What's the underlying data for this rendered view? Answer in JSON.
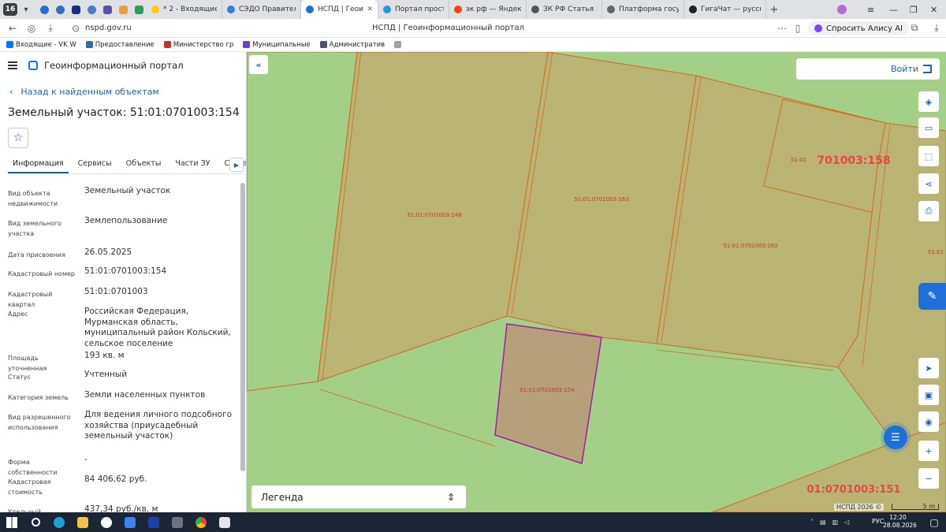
{
  "browser": {
    "tab_count": "16",
    "tabs": [
      {
        "label": "* 2 - Входящие — Я",
        "color": "#ffcc00"
      },
      {
        "label": "СЭДО Правительс",
        "color": "#3a7bd5"
      },
      {
        "label": "НСПД | Геоинфо",
        "color": "#1f6fd9",
        "active": true
      },
      {
        "label": "Портал пространс",
        "color": "#1f9bd9"
      },
      {
        "label": "эк рф — Яндекс: на",
        "color": "#fc3f1d"
      },
      {
        "label": "ЗК РФ Статья 39.6.",
        "color": "#555555"
      },
      {
        "label": "Платформа госуда",
        "color": "#666666"
      },
      {
        "label": "ГигаЧат — русско",
        "color": "#222222"
      }
    ],
    "url": "nspd.gov.ru",
    "page_title": "НСПД | Геоинформационный портал",
    "alice_label": "Спросить Алису AI",
    "bookmarks": [
      {
        "label": "Входящие - VK W",
        "color": "#0077ff"
      },
      {
        "label": "Предоставление",
        "color": "#2b6cb0"
      },
      {
        "label": "Министерство гр",
        "color": "#c53030"
      },
      {
        "label": "Муниципальные",
        "color": "#6b46c1"
      },
      {
        "label": "Административ",
        "color": "#4a5568"
      }
    ]
  },
  "panel": {
    "app_name": "Геоинформационный портал",
    "back_label": "Назад к найденным объектам",
    "object_title": "Земельный участок: 51:01:0701003:154",
    "tabs": [
      "Информация",
      "Сервисы",
      "Объекты",
      "Части ЗУ",
      "Состав"
    ],
    "properties": [
      {
        "label": "Вид объекта недвижимости",
        "value": "Земельный участок"
      },
      {
        "label": "Вид земельного участка",
        "value": "Землепользование"
      },
      {
        "label": "Дата присвоения",
        "value": "26.05.2025"
      },
      {
        "label": "Кадастровый номер",
        "value": "51:01:0701003:154"
      },
      {
        "label": "Кадастровый квартал",
        "value": "51:01:0701003"
      },
      {
        "label": "Адрес",
        "value": "Российская Федерация, Мурманская область, муниципальный район Кольский, сельское поселение"
      },
      {
        "label": "Площадь уточненная",
        "value": "193 кв. м"
      },
      {
        "label": "Статус",
        "value": "Учтенный"
      },
      {
        "label": "Категория земель",
        "value": "Земли населенных пунктов"
      },
      {
        "label": "Вид разрешенного использования",
        "value": "Для ведения личного подсобного хозяйства (приусадебный земельный участок)"
      },
      {
        "label": "Форма собственности",
        "value": "-"
      },
      {
        "label": "Кадастровая стоимость",
        "value": "84 406,62 руб."
      },
      {
        "label": "Удельный показатель",
        "value": "437,34 руб./кв. м"
      }
    ]
  },
  "map": {
    "login_label": "Войти",
    "legend_label": "Легенда",
    "attribution": "НСПД 2026 ©",
    "scale_label": "5 m",
    "parcel_labels": [
      {
        "text": "51:01:0701003:148"
      },
      {
        "text": "51:01:0701003:163"
      },
      {
        "text": "51:01:0701003:162"
      },
      {
        "text": "51:01:0701003:154"
      },
      {
        "text": "51:01"
      },
      {
        "text": "701003:158"
      },
      {
        "text": "01:0701003:151"
      },
      {
        "text": "51:01"
      }
    ],
    "colors": {
      "background": "#a3cf86",
      "parcel_fill": "#bab474",
      "parcel_border": "#d2691e",
      "selected_fill": "#b6a07a",
      "selected_border": "#a020a0"
    }
  },
  "taskbar": {
    "language": "РУС",
    "time": "12:20",
    "date": "28.08.2026"
  }
}
